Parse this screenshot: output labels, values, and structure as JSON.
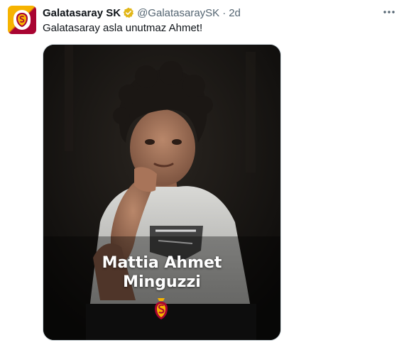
{
  "tweet": {
    "author_name": "Galatasaray SK",
    "author_handle": "@GalatasaraySK",
    "separator": "·",
    "time": "2d",
    "text": "Galatasaray asla unutmaz Ahmet!",
    "avatar_icon": "galatasaray-crest-icon",
    "verified_icon": "verified-badge-icon",
    "more_icon": "more-options-icon"
  },
  "media": {
    "name_line1": "Mattia Ahmet",
    "name_line2": "Minguzzi",
    "logo_icon": "galatasaray-logo-icon"
  },
  "colors": {
    "text": "#0f1419",
    "muted": "#536471",
    "verified_gold": "#e2b719",
    "brand_yellow": "#f6b300",
    "brand_red": "#a90432"
  }
}
